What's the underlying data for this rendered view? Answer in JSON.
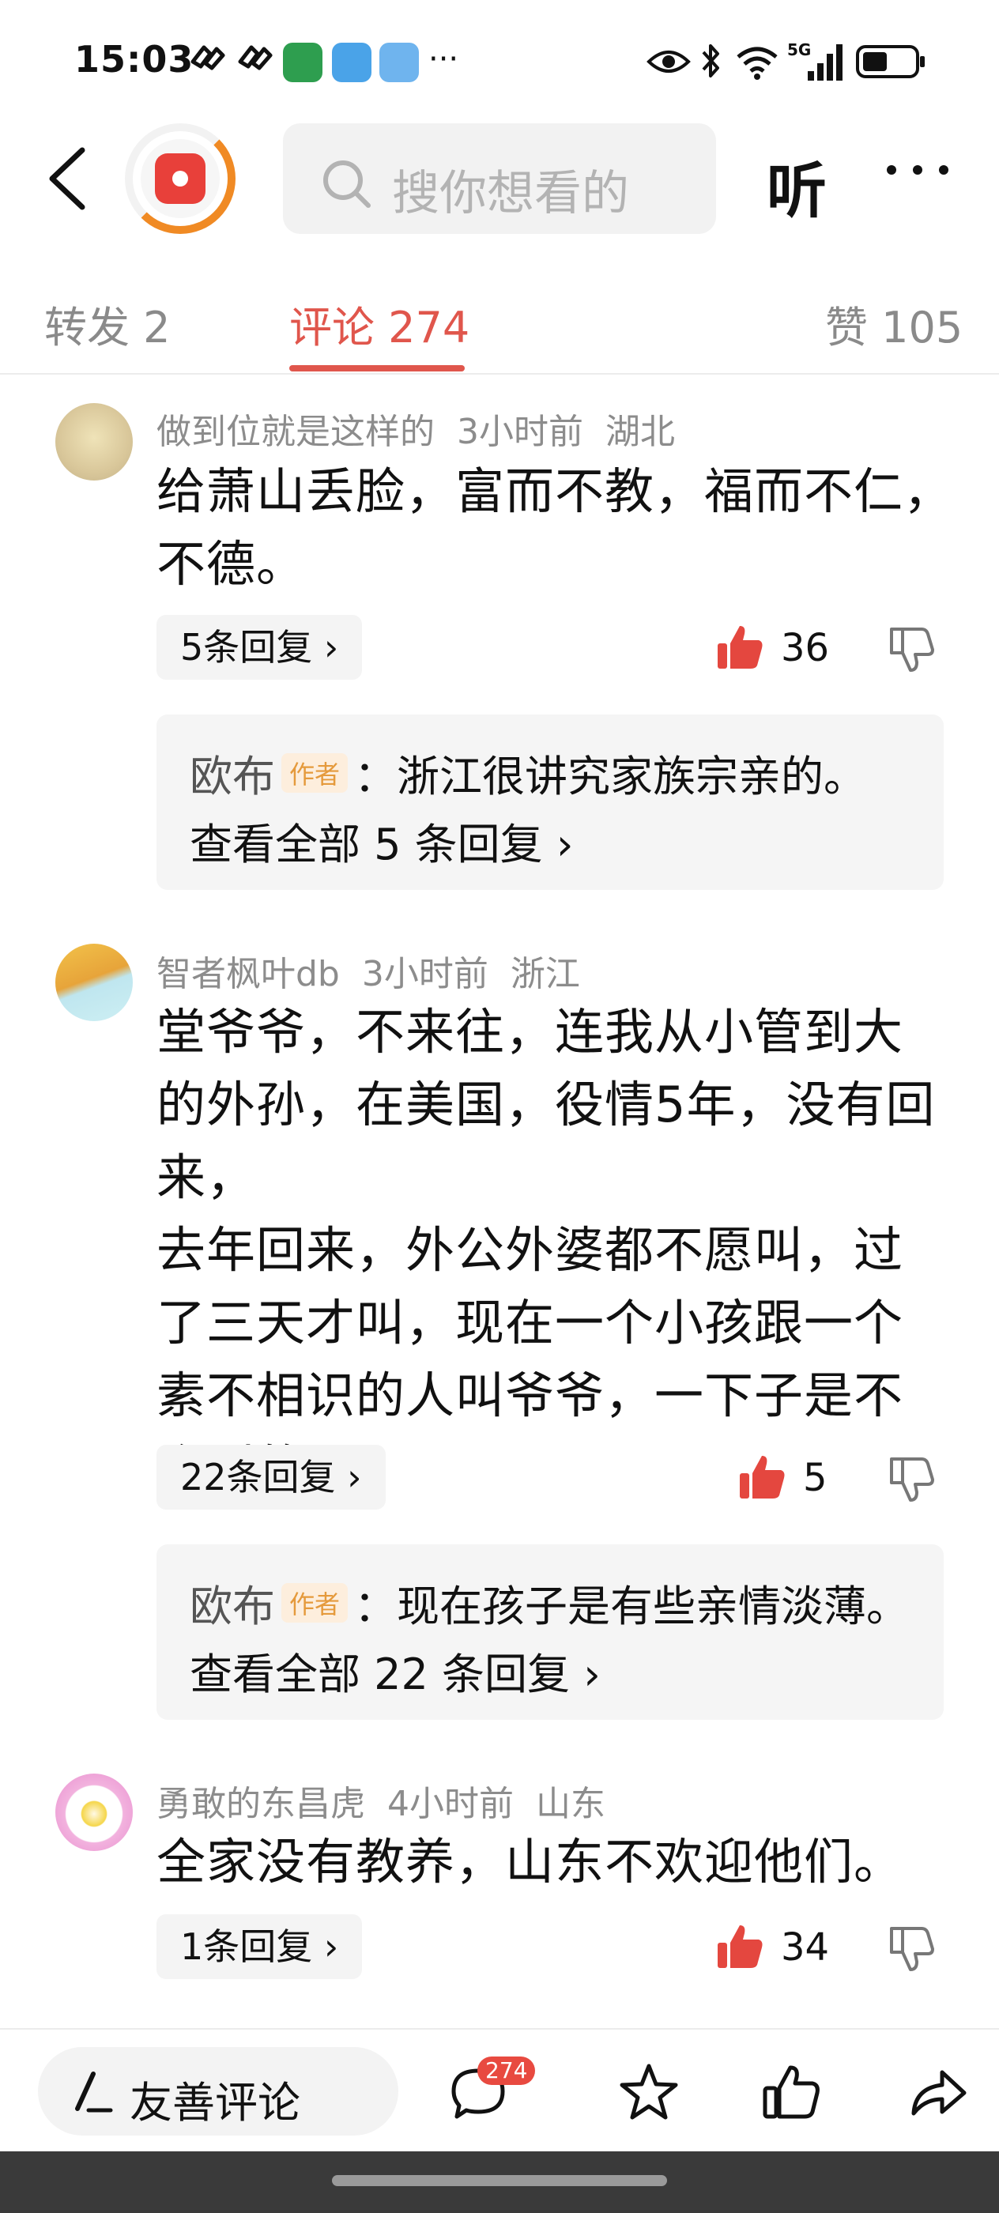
{
  "status_bar": {
    "time": "15:03",
    "more": "···",
    "network": "5G",
    "icons": [
      "notification-icon",
      "notification-icon",
      "app-store-icon",
      "reader-icon",
      "weather-icon",
      "eye-icon",
      "bluetooth-icon",
      "wifi-icon",
      "signal-icon",
      "battery-icon"
    ]
  },
  "top_nav": {
    "back_icon": "chevron-left-icon",
    "logo_icon": "red-app-logo-icon",
    "search_placeholder": "搜你想看的",
    "listen_label": "听",
    "menu_icon": "more-dots-icon"
  },
  "tabs": [
    {
      "label": "转发 2",
      "active": false
    },
    {
      "label": "评论 274",
      "active": true
    },
    {
      "label": "赞 105",
      "active": false
    }
  ],
  "accent_color": "#e0564c",
  "comments": [
    {
      "username": "做到位就是这样的",
      "time": "3小时前",
      "location": "湖北",
      "lines": [
        "给萧山丢脸，富而不教，福而不仁，",
        "不德。"
      ],
      "reply_label": "5条回复 ›",
      "likes": "36",
      "author_reply": {
        "name": "欧布",
        "tag": "作者",
        "text": "：浙江很讲究家族宗亲的。",
        "see_all": "查看全部 5 条回复 ›"
      }
    },
    {
      "username": "智者枫叶db",
      "time": "3小时前",
      "location": "浙江",
      "lines": [
        "堂爷爷，不来往，连我从小管到大",
        "的外孙，在美国，役情5年，没有回来，",
        "去年回来，外公外婆都不愿叫，过",
        "了三天才叫，现在一个小孩跟一个",
        "素不相识的人叫爷爷，一下子是不",
        "会叫的。"
      ],
      "reply_label": "22条回复 ›",
      "likes": "5",
      "author_reply": {
        "name": "欧布",
        "tag": "作者",
        "text": "：现在孩子是有些亲情淡薄。",
        "see_all": "查看全部 22 条回复 ›"
      }
    },
    {
      "username": "勇敢的东昌虎",
      "time": "4小时前",
      "location": "山东",
      "lines": [
        "全家没有教养，山东不欢迎他们。"
      ],
      "reply_label": "1条回复 ›",
      "likes": "34"
    }
  ],
  "bottom_bar": {
    "compose_label": "友善评论",
    "comment_badge": "274",
    "icons": [
      "pen-icon",
      "comment-icon",
      "star-icon",
      "thumb-up-icon",
      "share-icon"
    ]
  }
}
